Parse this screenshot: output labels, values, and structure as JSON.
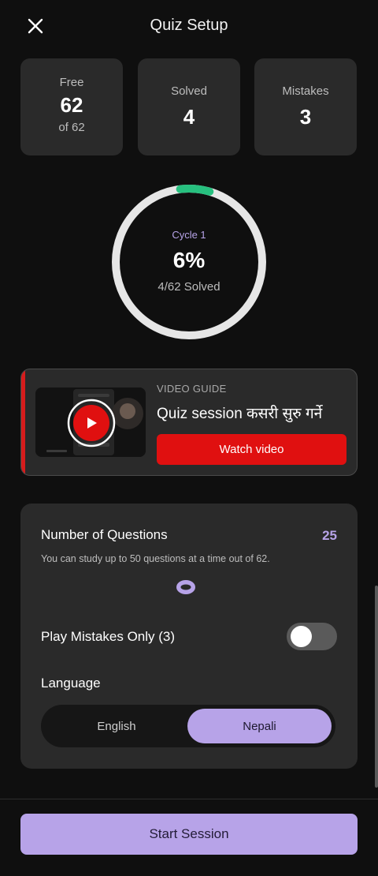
{
  "header": {
    "title": "Quiz Setup",
    "close_icon": "close-icon"
  },
  "stats": {
    "free": {
      "label": "Free",
      "value": "62",
      "sub": "of 62"
    },
    "solved": {
      "label": "Solved",
      "value": "4"
    },
    "mistakes": {
      "label": "Mistakes",
      "value": "3"
    }
  },
  "progress": {
    "cycle": "Cycle 1",
    "percent_text": "6%",
    "solved_text": "4/62 Solved",
    "fraction": 0.065,
    "accent_color": "#27c07f",
    "track_color": "#e6e6e6"
  },
  "video": {
    "kicker": "VIDEO GUIDE",
    "title": "Quiz session कसरी सुरु गर्ने",
    "button_label": "Watch video",
    "play_icon": "play-icon",
    "accent_color": "#e01010"
  },
  "settings": {
    "questions_label": "Number of Questions",
    "questions_value": "25",
    "questions_help": "You can study up to 50 questions at a time out of 62.",
    "slider_fraction": 0.5,
    "mistakes_label": "Play Mistakes Only (3)",
    "mistakes_toggle_on": false,
    "language_label": "Language",
    "languages": [
      "English",
      "Nepali"
    ],
    "selected_language": "Nepali"
  },
  "footer": {
    "start_label": "Start Session",
    "accent_color": "#b7a3e8"
  }
}
